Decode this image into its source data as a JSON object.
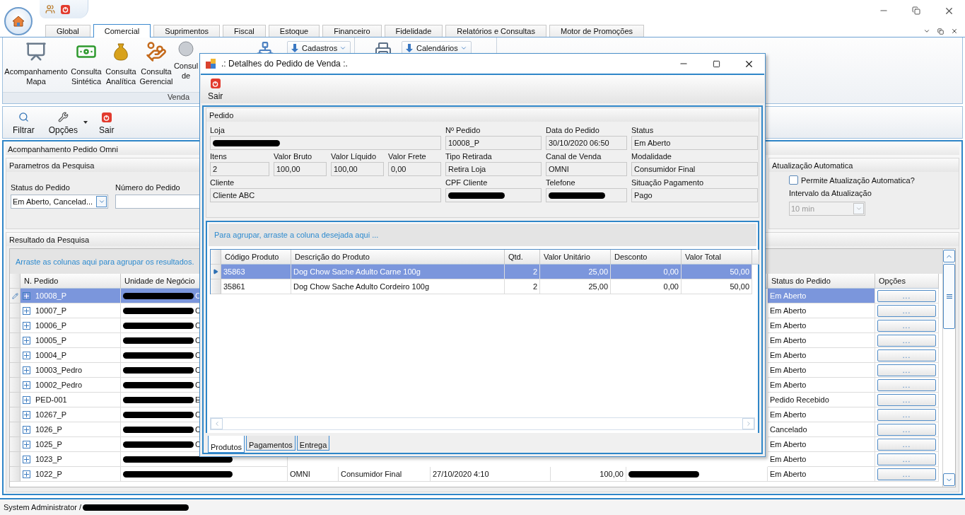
{
  "tabs": [
    {
      "label": "Global",
      "selected": false
    },
    {
      "label": "Comercial",
      "selected": true
    },
    {
      "label": "Suprimentos",
      "selected": false
    },
    {
      "label": "Fiscal",
      "selected": false
    },
    {
      "label": "Estoque",
      "selected": false
    },
    {
      "label": "Financeiro",
      "selected": false
    },
    {
      "label": "Fidelidade",
      "selected": false
    },
    {
      "label": "Relatórios e Consultas",
      "selected": false
    },
    {
      "label": "Motor de Promoções",
      "selected": false
    }
  ],
  "ribbon": {
    "groups": [
      {
        "label": "Venda",
        "items": [
          {
            "lines": [
              "Acompanhamento",
              "Mapa"
            ]
          },
          {
            "lines": [
              "Consulta",
              "Sintética"
            ]
          },
          {
            "lines": [
              "Consulta",
              "Analítica"
            ]
          },
          {
            "lines": [
              "Consulta",
              "Gerencial"
            ]
          },
          {
            "lines": [
              "Consul",
              "de"
            ]
          }
        ],
        "menus": [
          {
            "label": "Cadastros"
          }
        ]
      },
      {
        "menus": [
          {
            "label": "Calendários"
          }
        ]
      }
    ]
  },
  "toolbar": [
    {
      "label": "Filtrar",
      "has_menu": false
    },
    {
      "label": "Opções",
      "has_menu": true
    },
    {
      "label": "Sair",
      "has_menu": false
    }
  ],
  "panel": {
    "title": "Acompanhamento Pedido Omni"
  },
  "search_params": {
    "title": "Parametros da Pesquisa",
    "fields": [
      {
        "label": "Status do Pedido",
        "kind": "combo",
        "value": "Em Aberto, Cancelad..."
      },
      {
        "label": "Número do Pedido",
        "kind": "text"
      }
    ]
  },
  "auto_update": {
    "title": "Atualização Automatica",
    "checkbox": {
      "label": "Permite Atualização Automatica?",
      "checked": false
    },
    "interval": {
      "label": "Intervalo da Atualização",
      "value": "10 min",
      "disabled": true
    }
  },
  "results": {
    "title": "Resultado da Pesquisa",
    "group_hint": "Arraste as colunas aqui para agrupar os resultados.",
    "columns": [
      "N. Pedido",
      "Unidade de Negócio",
      "",
      "",
      "",
      "",
      "",
      "Status do Pedido",
      "Opções"
    ],
    "rows": [
      {
        "selected": true,
        "cells": [
          "10008_P",
          {
            "redacted": true,
            "tail": "C"
          },
          null,
          null,
          null,
          null,
          null,
          "Em Aberto",
          "..."
        ]
      },
      {
        "selected": false,
        "cells": [
          "10007_P",
          {
            "redacted": true,
            "tail": "C"
          },
          null,
          null,
          null,
          null,
          null,
          "Em Aberto",
          "..."
        ]
      },
      {
        "selected": false,
        "cells": [
          "10006_P",
          {
            "redacted": true,
            "tail": "C"
          },
          null,
          null,
          null,
          null,
          null,
          "Em Aberto",
          "..."
        ]
      },
      {
        "selected": false,
        "cells": [
          "10005_P",
          {
            "redacted": true,
            "tail": "C"
          },
          null,
          null,
          null,
          null,
          null,
          "Em Aberto",
          "..."
        ]
      },
      {
        "selected": false,
        "cells": [
          "10004_P",
          {
            "redacted": true,
            "tail": "C"
          },
          null,
          null,
          null,
          null,
          null,
          "Em Aberto",
          "..."
        ]
      },
      {
        "selected": false,
        "cells": [
          "10003_Pedro",
          {
            "redacted": true,
            "tail": "C"
          },
          null,
          null,
          null,
          null,
          null,
          "Em Aberto",
          "..."
        ]
      },
      {
        "selected": false,
        "cells": [
          "10002_Pedro",
          {
            "redacted": true,
            "tail": "C"
          },
          null,
          null,
          null,
          null,
          null,
          "Em Aberto",
          "..."
        ]
      },
      {
        "selected": false,
        "cells": [
          "PED-001",
          {
            "redacted": true,
            "tail": "E"
          },
          null,
          null,
          null,
          null,
          null,
          "Pedido Recebido",
          "..."
        ]
      },
      {
        "selected": false,
        "cells": [
          "10267_P",
          {
            "redacted": true,
            "tail": "C"
          },
          null,
          null,
          null,
          null,
          null,
          "Em Aberto",
          "..."
        ]
      },
      {
        "selected": false,
        "cells": [
          "1026_P",
          {
            "redacted": true,
            "tail": "C"
          },
          null,
          null,
          null,
          null,
          null,
          "Cancelado",
          "..."
        ]
      },
      {
        "selected": false,
        "cells": [
          "1025_P",
          {
            "redacted": true,
            "tail": "C"
          },
          null,
          null,
          null,
          null,
          null,
          "Em Aberto",
          "..."
        ]
      },
      {
        "selected": false,
        "cells": [
          "1023_P",
          {
            "redacted": true
          },
          null,
          null,
          null,
          null,
          null,
          "Em Aberto",
          "..."
        ]
      },
      {
        "selected": false,
        "cells": [
          "1022_P",
          {
            "redacted": true
          },
          "OMNI",
          "Consumidor Final",
          "27/10/2020 4:10",
          "100,00",
          {
            "redacted": true
          },
          "Em Aberto",
          "..."
        ]
      }
    ]
  },
  "status_bar": {
    "user": "System Administrator /",
    "redacted": true
  },
  "dialog": {
    "title": ".: Detalhes do Pedido de Venda :.",
    "toolbar": [
      {
        "label": "Sair"
      }
    ],
    "group": {
      "title": "Pedido",
      "fields": [
        {
          "label": "Loja",
          "redacted": true
        },
        {
          "label": "Nº Pedido",
          "value": "10008_P"
        },
        {
          "label": "Data do Pedido",
          "value": "30/10/2020 06:50"
        },
        {
          "label": "Status",
          "value": "Em Aberto"
        },
        {
          "label": "Itens",
          "value": "2"
        },
        {
          "label": "Valor Bruto",
          "value": "100,00"
        },
        {
          "label": "Valor Líquido",
          "value": "100,00"
        },
        {
          "label": "Valor Frete",
          "value": "0,00"
        },
        {
          "label": "Tipo Retirada",
          "value": "Retira Loja"
        },
        {
          "label": "Canal de Venda",
          "value": "OMNI"
        },
        {
          "label": "Modalidade",
          "value": "Consumidor Final"
        },
        {
          "label": "Cliente",
          "value": "Cliente ABC"
        },
        {
          "label": "CPF Cliente",
          "redacted": true
        },
        {
          "label": "Telefone",
          "redacted": true
        },
        {
          "label": "Situação Pagamento",
          "value": "Pago"
        }
      ]
    },
    "grid": {
      "group_hint": "Para agrupar, arraste a coluna desejada aqui ...",
      "columns": [
        {
          "header": "Código Produto"
        },
        {
          "header": "Descrição do Produto"
        },
        {
          "header": "Qtd."
        },
        {
          "header": "Valor Unitário"
        },
        {
          "header": "Desconto"
        },
        {
          "header": "Valor Total"
        }
      ],
      "rows": [
        {
          "selected": true,
          "cells": [
            "35863",
            "Dog Chow Sache Adulto Carne 100g",
            "2",
            "25,00",
            "0,00",
            "50,00"
          ]
        },
        {
          "selected": false,
          "cells": [
            "35861",
            "Dog Chow Sache Adulto Cordeiro 100g",
            "2",
            "25,00",
            "0,00",
            "50,00"
          ]
        }
      ]
    },
    "tabs": [
      {
        "label": "Produtos",
        "selected": true
      },
      {
        "label": "Pagamentos",
        "selected": false
      },
      {
        "label": "Entrega",
        "selected": false
      }
    ]
  }
}
